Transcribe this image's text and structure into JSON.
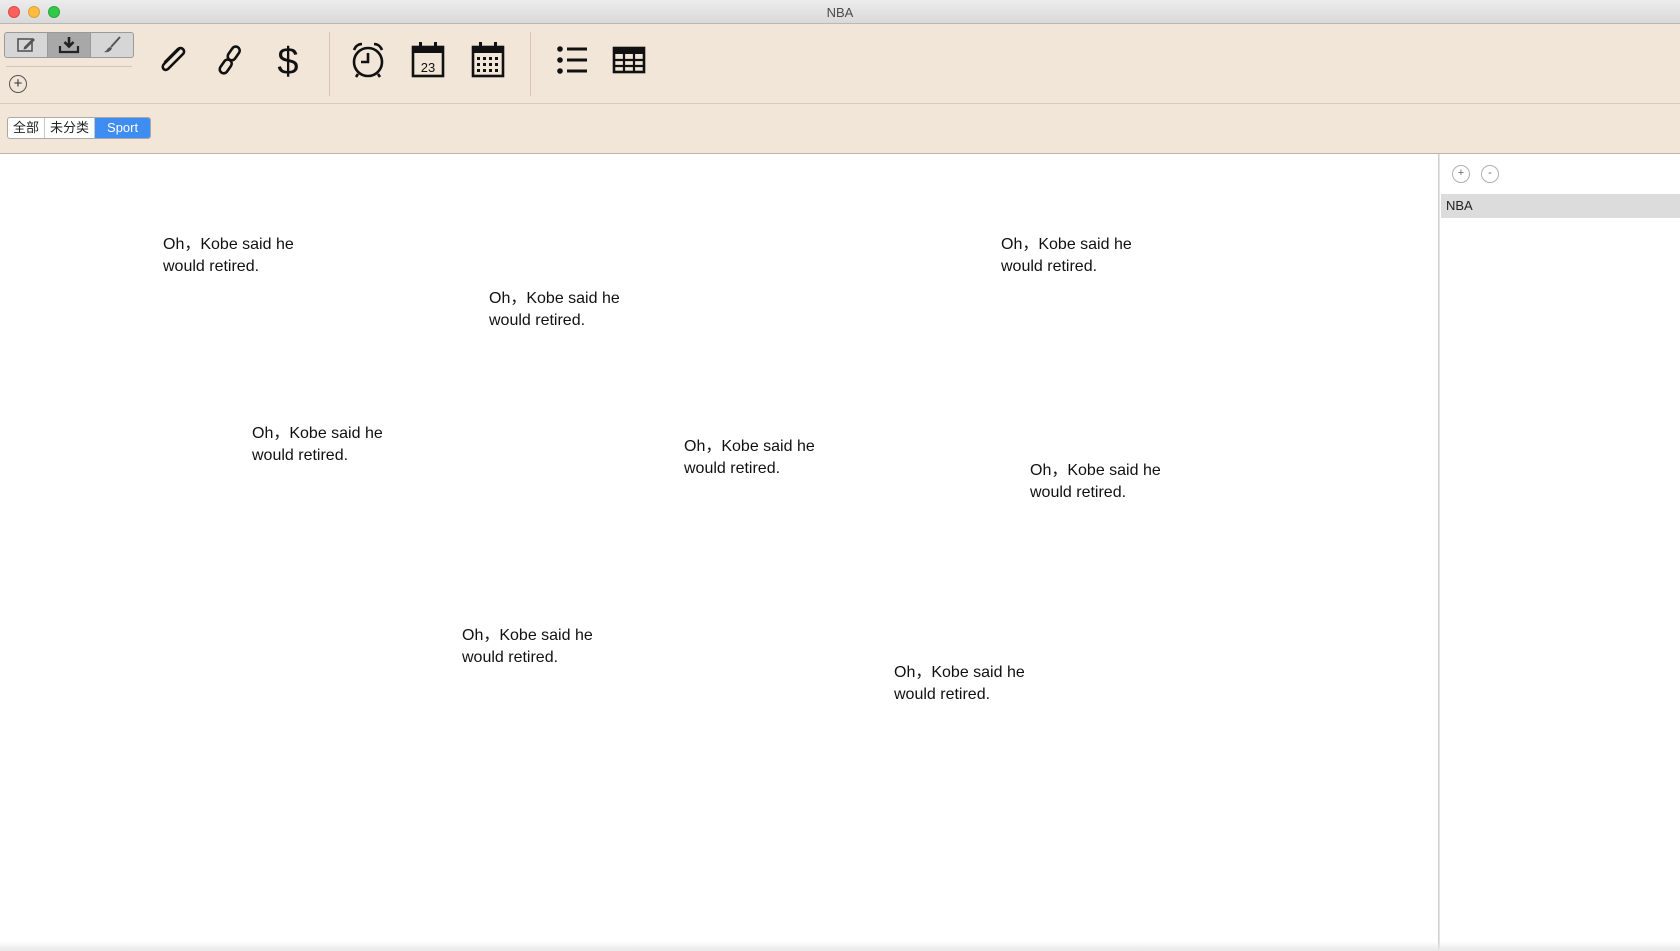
{
  "window": {
    "title": "NBA"
  },
  "toolbar": {
    "mode_buttons": [
      {
        "icon": "edit-icon"
      },
      {
        "icon": "download-icon"
      },
      {
        "icon": "brush-icon"
      }
    ],
    "add_label": "+",
    "tools": [
      {
        "icon": "paperclip-icon"
      },
      {
        "icon": "link-icon"
      },
      {
        "icon": "dollar-icon"
      },
      {
        "icon": "alarm-clock-icon"
      },
      {
        "icon": "calendar-day-icon",
        "day": "23"
      },
      {
        "icon": "calendar-month-icon"
      },
      {
        "icon": "list-icon"
      },
      {
        "icon": "table-icon"
      }
    ]
  },
  "tags": [
    {
      "label": "全部",
      "active": false
    },
    {
      "label": "未分类",
      "active": false
    },
    {
      "label": "Sport",
      "active": true
    }
  ],
  "notes": [
    {
      "line1": "Oh，Kobe said he",
      "line2": "would retired."
    },
    {
      "line1": "Oh，Kobe said he",
      "line2": "would retired."
    },
    {
      "line1": "Oh，Kobe said he",
      "line2": "would retired."
    },
    {
      "line1": "Oh，Kobe said he",
      "line2": "would retired."
    },
    {
      "line1": "Oh，Kobe said he",
      "line2": "would retired."
    },
    {
      "line1": "Oh，Kobe said he",
      "line2": "would retired."
    },
    {
      "line1": "Oh，Kobe said he",
      "line2": "would retired."
    },
    {
      "line1": "Oh，Kobe said he",
      "line2": "would retired."
    }
  ],
  "sidebar": {
    "add_label": "+",
    "remove_label": "-",
    "items": [
      {
        "label": "NBA",
        "selected": true
      }
    ]
  }
}
